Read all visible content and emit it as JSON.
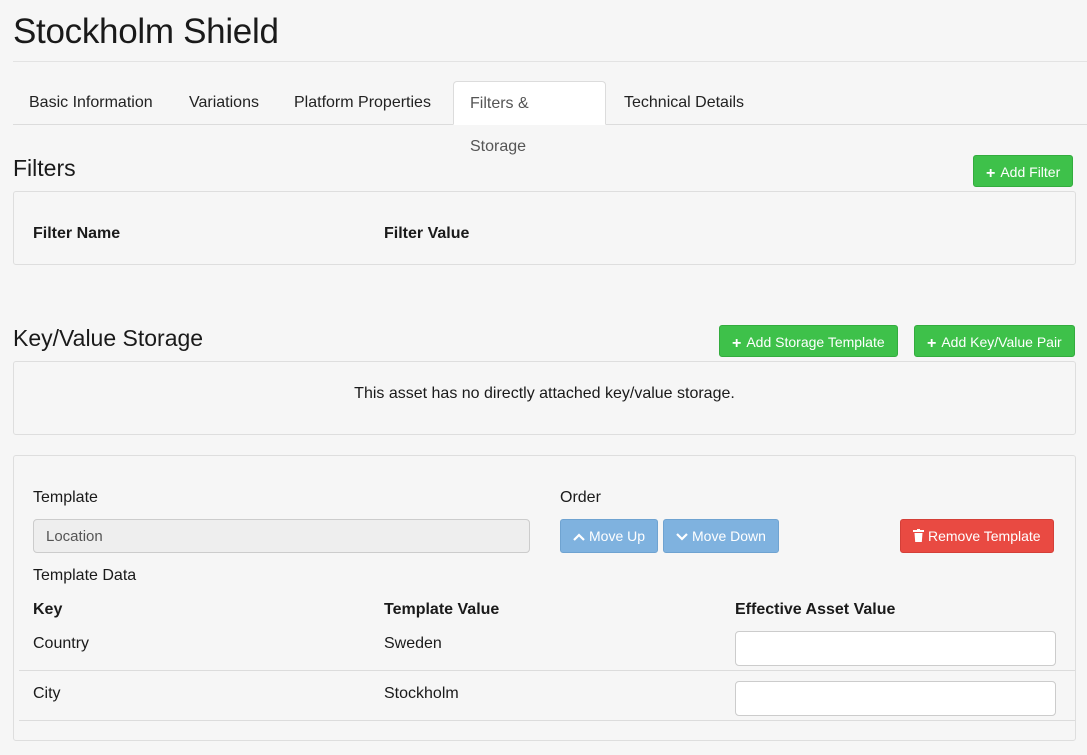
{
  "page": {
    "title": "Stockholm Shield"
  },
  "tabs": [
    {
      "label": "Basic Information"
    },
    {
      "label": "Variations"
    },
    {
      "label": "Platform Properties"
    },
    {
      "label": "Filters & Storage",
      "active": true
    },
    {
      "label": "Technical Details"
    }
  ],
  "filters": {
    "title": "Filters",
    "add_button": "Add Filter",
    "columns": [
      "Filter Name",
      "Filter Value"
    ]
  },
  "kv_storage": {
    "title": "Key/Value Storage",
    "add_template_button": "Add Storage Template",
    "add_pair_button": "Add Key/Value Pair",
    "empty_message": "This asset has no directly attached key/value storage."
  },
  "template": {
    "template_label": "Template",
    "template_value": "Location",
    "order_label": "Order",
    "move_up": "Move Up",
    "move_down": "Move Down",
    "remove": "Remove Template",
    "data_label": "Template Data",
    "columns": [
      "Key",
      "Template Value",
      "Effective Asset Value"
    ],
    "rows": [
      {
        "key": "Country",
        "template_value": "Sweden",
        "effective_value": ""
      },
      {
        "key": "City",
        "template_value": "Stockholm",
        "effective_value": ""
      }
    ]
  },
  "colors": {
    "green": "#3ec14a",
    "blue": "#7fb2df",
    "red": "#e94a42"
  },
  "icons": [
    "plus-icon",
    "chevron-up-icon",
    "chevron-down-icon",
    "trash-icon"
  ]
}
